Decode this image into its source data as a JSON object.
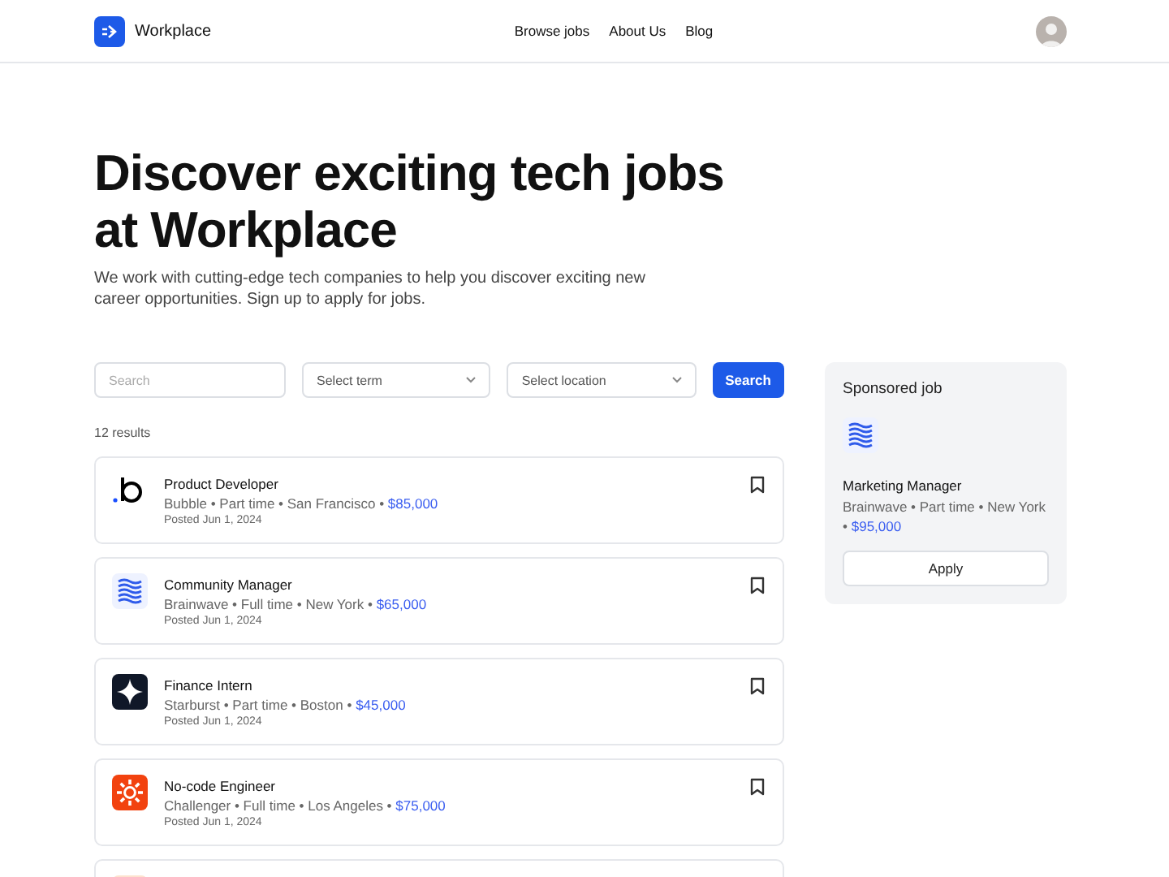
{
  "header": {
    "brand": "Workplace",
    "nav": [
      {
        "label": "Browse jobs"
      },
      {
        "label": "About Us"
      },
      {
        "label": "Blog"
      }
    ]
  },
  "hero": {
    "title": "Discover exciting tech jobs at Workplace",
    "subtitle": "We work with cutting-edge tech companies to help you discover exciting new career opportunities. Sign up to apply for jobs."
  },
  "filters": {
    "search": {
      "placeholder": "Search"
    },
    "term": {
      "placeholder": "Select term"
    },
    "location": {
      "placeholder": "Select location"
    },
    "button": "Search"
  },
  "results_count": "12 results",
  "jobs": [
    {
      "kind": "bubble",
      "title": "Product Developer",
      "details": "Bubble • Part time • San Francisco •",
      "salary": "$85,000",
      "posted": "Posted Jun 1, 2024"
    },
    {
      "kind": "brainwave",
      "title": "Community Manager",
      "details": "Brainwave • Full time • New York •",
      "salary": "$65,000",
      "posted": "Posted Jun 1, 2024"
    },
    {
      "kind": "starburst",
      "title": "Finance Intern",
      "details": "Starburst • Part time • Boston •",
      "salary": "$45,000",
      "posted": "Posted Jun 1, 2024"
    },
    {
      "kind": "challenger",
      "title": "No-code Engineer",
      "details": "Challenger • Full time • Los Angeles •",
      "salary": "$75,000",
      "posted": "Posted Jun 1, 2024"
    },
    {
      "kind": "brand"
    }
  ],
  "sponsored": {
    "heading": "Sponsored job",
    "kind": "brainwave",
    "title": "Marketing Manager",
    "details": "Brainwave • Part time • New York •",
    "salary": "$95,000",
    "button": "Apply"
  }
}
